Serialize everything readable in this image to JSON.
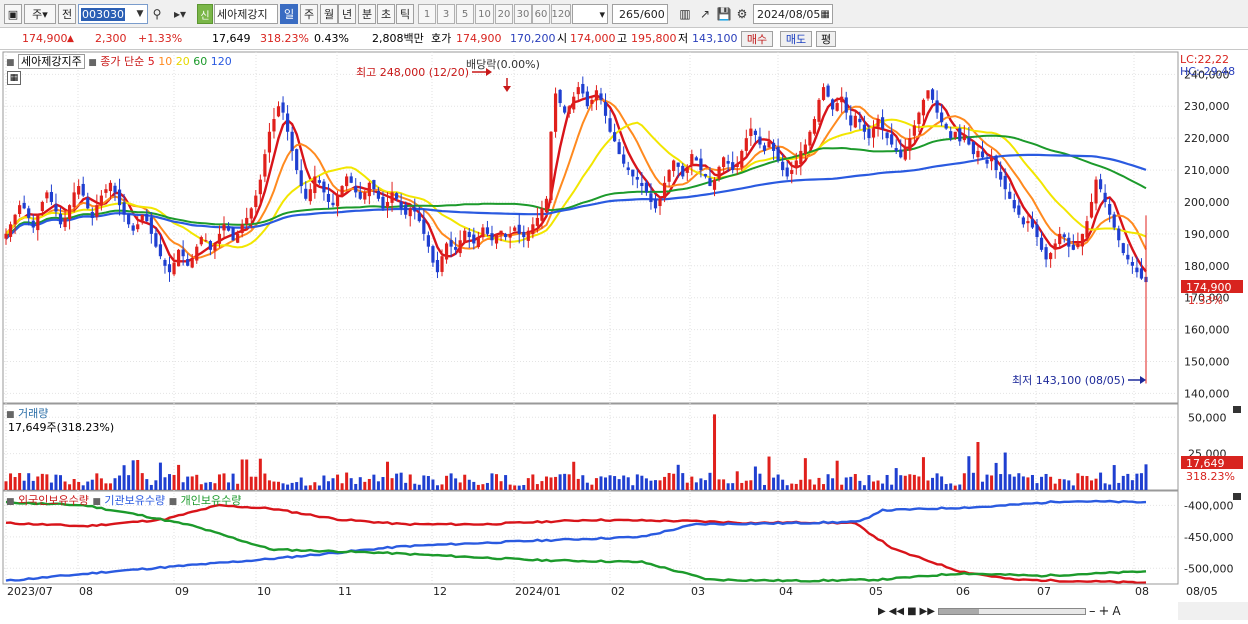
{
  "toolbar": {
    "period_type": "주",
    "prefix": "전",
    "code": "003030",
    "badge": "신",
    "stock_name": "세아제강지",
    "periods": [
      "일",
      "주",
      "월",
      "년",
      "분",
      "초",
      "틱"
    ],
    "active_period": "일",
    "intervals": [
      "1",
      "3",
      "5",
      "10",
      "20",
      "30",
      "60",
      "120"
    ],
    "count": "265",
    "count_total": "/600",
    "date": "2024/08/05"
  },
  "info": {
    "price": "174,900",
    "change": "2,300",
    "change_pct": "+1.33%",
    "volume": "17,649",
    "vol_ratio": "318.23%",
    "turnover": "0.43%",
    "amount": "2,808백만",
    "quote_label": "호가",
    "bid": "174,900",
    "ask": "170,200",
    "open_label": "시",
    "open": "174,000",
    "high_label": "고",
    "high": "195,800",
    "low_label": "저",
    "low": "143,100",
    "buy_btn": "매수",
    "sell_btn": "매도",
    "eval_btn": "평"
  },
  "price_panel": {
    "title": "세아제강지주",
    "ma_label": "종가 단순",
    "ma_periods": [
      "5",
      "10",
      "20",
      "60",
      "120"
    ],
    "ma_colors": [
      "#d8141a",
      "#ff8a1f",
      "#f2e600",
      "#1c9a2b",
      "#2a5ae0"
    ],
    "lc_label": "LC:22,22",
    "hc_label": "HC:-29,48",
    "max_note": "최고 248,000 (12/20)",
    "dividend_note": "배당락(0.00%)",
    "min_note": "최저 143,100 (08/05)",
    "last_price_tag": "174,900",
    "last_pct_tag": "1.33%",
    "y_ticks": [
      "240,000",
      "230,000",
      "220,000",
      "210,000",
      "200,000",
      "190,000",
      "180,000",
      "170,000",
      "160,000",
      "150,000",
      "140,000"
    ]
  },
  "volume_panel": {
    "title": "거래량",
    "value": "17,649주(318.23%)",
    "y_ticks": [
      "50,000",
      "25,000"
    ],
    "last_tag": "17,649",
    "last_pct": "318.23%"
  },
  "holdings_panel": {
    "labels": [
      "외국인보유수량",
      "기관보유수량",
      "개인보유수량"
    ],
    "colors": [
      "#d8141a",
      "#2a5ae0",
      "#1c9a2b"
    ],
    "y_ticks": [
      "-400,000",
      "-450,000",
      "-500,000"
    ]
  },
  "x_axis": {
    "labels": [
      "2023/07",
      "08",
      "09",
      "10",
      "11",
      "12",
      "2024/01",
      "02",
      "03",
      "04",
      "05",
      "06",
      "07",
      "08",
      "08/05"
    ]
  },
  "chart_data": {
    "type": "candlestick",
    "ylim": [
      137000,
      247000
    ],
    "closes": [
      190000,
      193000,
      196000,
      199000,
      198000,
      195000,
      192000,
      196000,
      200000,
      203000,
      200000,
      197000,
      193000,
      195000,
      199000,
      203000,
      205000,
      202000,
      198000,
      195000,
      199000,
      202000,
      204000,
      206000,
      203000,
      199000,
      196000,
      193000,
      191000,
      193000,
      196000,
      194000,
      190000,
      186000,
      183000,
      180000,
      178000,
      181000,
      185000,
      183000,
      180000,
      182000,
      186000,
      189000,
      188000,
      185000,
      187000,
      190000,
      193000,
      191000,
      188000,
      190000,
      193000,
      195000,
      198000,
      202000,
      207000,
      215000,
      222000,
      226000,
      230000,
      228000,
      222000,
      216000,
      210000,
      205000,
      201000,
      204000,
      208000,
      206000,
      203000,
      200000,
      199000,
      202000,
      205000,
      208000,
      206000,
      203000,
      201000,
      203000,
      206000,
      204000,
      201000,
      198000,
      200000,
      203000,
      201000,
      198000,
      196000,
      198000,
      197000,
      194000,
      190000,
      186000,
      181000,
      178000,
      183000,
      187000,
      186000,
      185000,
      188000,
      191000,
      189000,
      187000,
      189000,
      192000,
      190000,
      188000,
      190000,
      191000,
      189000,
      190000,
      192000,
      190000,
      189000,
      191000,
      193000,
      195000,
      198000,
      201000,
      222000,
      234000,
      231000,
      228000,
      230000,
      233000,
      236000,
      234000,
      230000,
      232000,
      235000,
      232000,
      227000,
      222000,
      219000,
      215000,
      212000,
      210000,
      208000,
      207000,
      205000,
      203000,
      200000,
      198000,
      201000,
      206000,
      210000,
      213000,
      211000,
      208000,
      211000,
      215000,
      213000,
      210000,
      208000,
      205000,
      207000,
      211000,
      214000,
      212000,
      210000,
      212000,
      216000,
      220000,
      223000,
      221000,
      218000,
      216000,
      219000,
      216000,
      213000,
      210000,
      208000,
      210000,
      213000,
      216000,
      218000,
      222000,
      226000,
      232000,
      236000,
      233000,
      229000,
      231000,
      233000,
      228000,
      224000,
      227000,
      225000,
      222000,
      220000,
      223000,
      226000,
      223000,
      220000,
      218000,
      216000,
      214000,
      217000,
      220000,
      224000,
      228000,
      232000,
      235000,
      232000,
      228000,
      225000,
      223000,
      220000,
      222000,
      219000,
      221000,
      218000,
      215000,
      216000,
      214000,
      212000,
      214000,
      210000,
      207000,
      204000,
      201000,
      198000,
      196000,
      193000,
      194000,
      192000,
      189000,
      185000,
      182000,
      184000,
      187000,
      190000,
      189000,
      186000,
      185000,
      187000,
      190000,
      194000,
      200000,
      207000,
      204000,
      200000,
      196000,
      192000,
      188000,
      184000,
      182000,
      180000,
      178000,
      176000,
      174900
    ],
    "volume_max": 55000,
    "x_labels": [
      "2023/07",
      "08",
      "09",
      "10",
      "11",
      "12",
      "2024/01",
      "02",
      "03",
      "04",
      "05",
      "06",
      "07",
      "08"
    ]
  }
}
